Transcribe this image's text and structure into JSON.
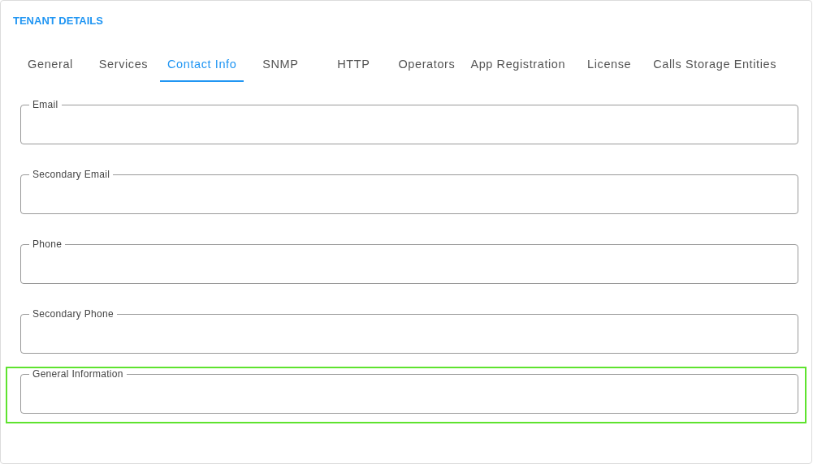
{
  "title": "TENANT DETAILS",
  "tabs": [
    {
      "label": "General",
      "selected": false
    },
    {
      "label": "Services",
      "selected": false
    },
    {
      "label": "Contact Info",
      "selected": true
    },
    {
      "label": "SNMP",
      "selected": false
    },
    {
      "label": "HTTP",
      "selected": false
    },
    {
      "label": "Operators",
      "selected": false
    },
    {
      "label": "App Registration",
      "selected": false
    },
    {
      "label": "License",
      "selected": false
    },
    {
      "label": "Calls Storage Entities",
      "selected": false
    }
  ],
  "fields": [
    {
      "label": "Email",
      "highlighted": false
    },
    {
      "label": "Secondary Email",
      "highlighted": false
    },
    {
      "label": "Phone",
      "highlighted": false
    },
    {
      "label": "Secondary Phone",
      "highlighted": false
    },
    {
      "label": "General Information",
      "highlighted": true
    }
  ]
}
